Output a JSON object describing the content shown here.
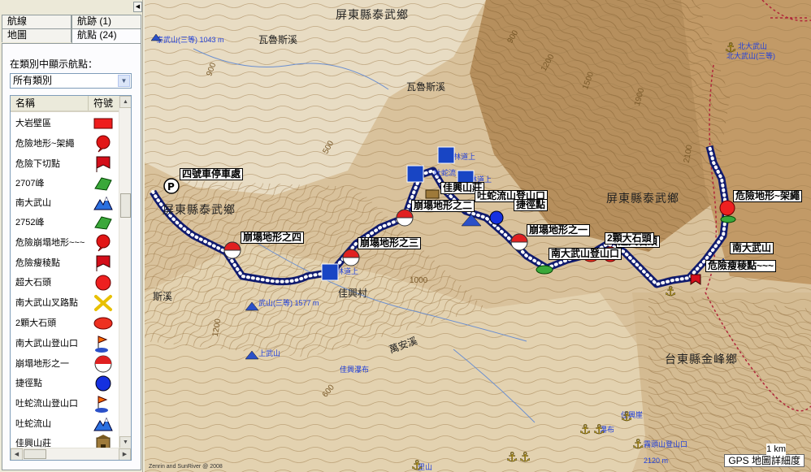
{
  "panel": {
    "tabs_row1": [
      "航線",
      "航跡 (1)"
    ],
    "tabs_row2": [
      "地圖",
      "航點 (24)"
    ],
    "filter_label": "在類別中顯示航點：",
    "category_value": "所有類別",
    "list_header": {
      "name": "名稱",
      "symbol": "符號"
    },
    "waypoints": [
      {
        "name": "大岩壁區",
        "symbol": "red-rectangle-icon"
      },
      {
        "name": "危險地形~架繩",
        "symbol": "red-pin-icon"
      },
      {
        "name": "危險下切點",
        "symbol": "red-flag-icon"
      },
      {
        "name": "2707峰",
        "symbol": "green-summit-icon"
      },
      {
        "name": "南大武山",
        "symbol": "blue-mountain-icon"
      },
      {
        "name": "2752峰",
        "symbol": "green-summit-icon"
      },
      {
        "name": "危險崩塌地形~~~",
        "symbol": "red-pin-icon"
      },
      {
        "name": "危險瘦稜點",
        "symbol": "red-flag-icon"
      },
      {
        "name": "超大石頭",
        "symbol": "red-circle-icon"
      },
      {
        "name": "南大武山叉路點",
        "symbol": "yellow-cross-icon"
      },
      {
        "name": "2顆大石頭",
        "symbol": "red-oval-icon"
      },
      {
        "name": "南大武山登山口",
        "symbol": "trailhead-flag-icon"
      },
      {
        "name": "崩塌地形之一",
        "symbol": "no-entry-icon"
      },
      {
        "name": "捷徑點",
        "symbol": "blue-circle-icon"
      },
      {
        "name": "吐蛇流山登山口",
        "symbol": "trailhead-flag-icon"
      },
      {
        "name": "吐蛇流山",
        "symbol": "blue-mountain-icon"
      },
      {
        "name": "佳興山莊",
        "symbol": "lodge-icon"
      }
    ]
  },
  "map": {
    "towns": [
      "屏東縣泰武鄉",
      "屏東縣泰武鄉",
      "屏東縣泰武鄉",
      "台東縣金峰鄉"
    ],
    "places": [
      "瓦魯斯溪",
      "瓦魯斯溪",
      "佳興村",
      "斯溪",
      "萬安溪"
    ],
    "contours": [
      "900",
      "1200",
      "1500",
      "1900",
      "2100",
      "500",
      "1000",
      "600",
      "1200",
      "900"
    ],
    "waypoint_labels": [
      "四號車停車處",
      "崩塌地形之四",
      "崩塌地形之三",
      "崩塌地形之二",
      "佳興山莊",
      "吐蛇流山登山口",
      "捷徑點",
      "崩塌地形之一",
      "南大武山登山口",
      "超大石頭",
      "2顆大石頭",
      "南大武山",
      "危險地形~架繩",
      "危險瘦稜點~~~"
    ],
    "blue_labels": [
      "泰武山(三等) 1043 m",
      "林道上",
      "林道上",
      "吐蛇流",
      "林道上",
      "武山(三等) 1577 m",
      "上武山",
      "佳興瀑布",
      "北大武山",
      "北大武山(三等)",
      "2120 m",
      "佳興崖",
      "瀑布",
      "霧頭山登山口",
      "里山"
    ],
    "copyright": "Zenrin and SunRiver @ 2008",
    "scale_km": "1 km",
    "scale_label": "GPS 地圖詳細度"
  }
}
